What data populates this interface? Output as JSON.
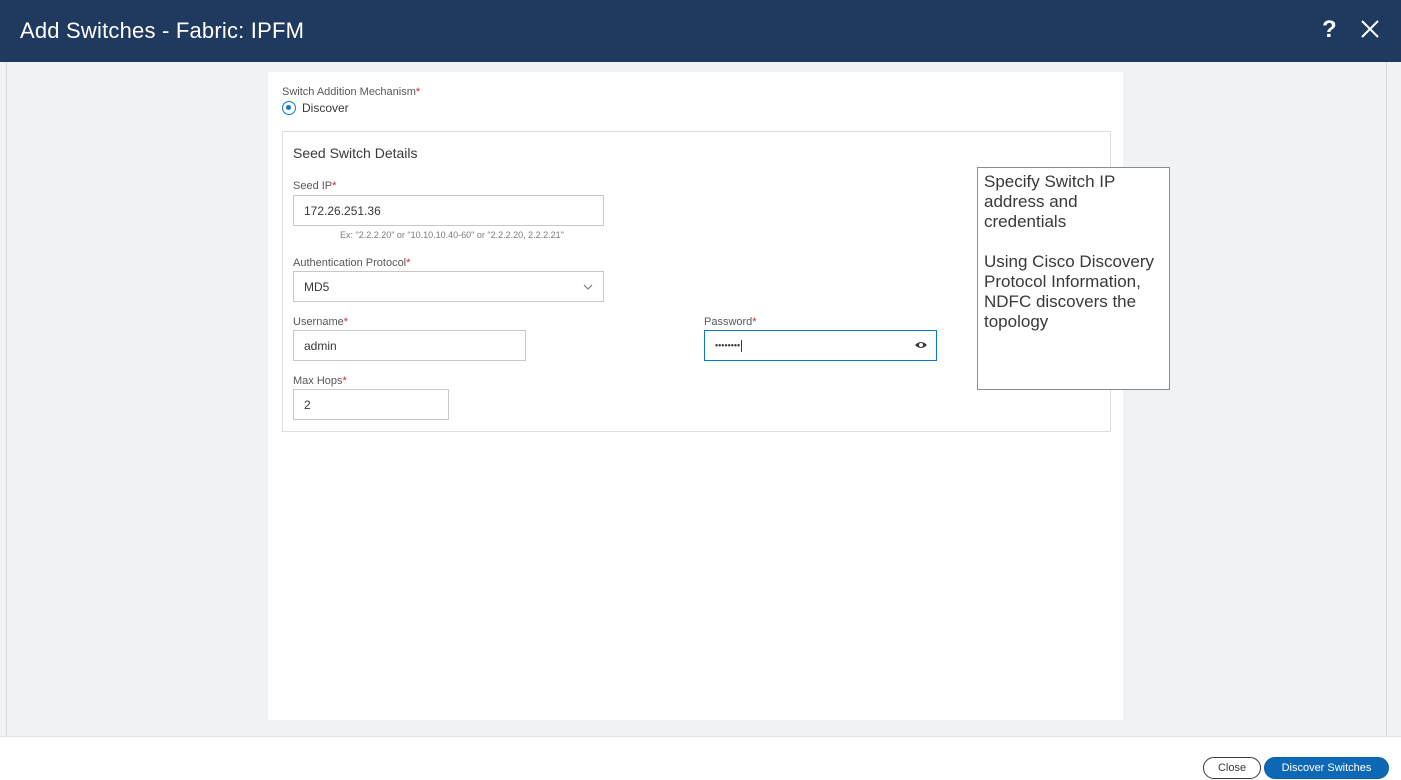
{
  "window": {
    "title": "Add Switches - Fabric: IPFM",
    "help_label": "?"
  },
  "mechanism": {
    "label": "Switch Addition Mechanism",
    "required_mark": "*",
    "option": "Discover"
  },
  "seed": {
    "section_title": "Seed Switch Details",
    "ip_label": "Seed IP",
    "ip_value": "172.26.251.36",
    "ip_hint": "Ex: \"2.2.2.20\" or \"10.10.10.40-60\" or \"2.2.2.20, 2.2.2.21\"",
    "auth_label": "Authentication Protocol",
    "auth_value": "MD5",
    "username_label": "Username",
    "username_value": "admin",
    "password_label": "Password",
    "password_masked": "••••••••",
    "maxhops_label": "Max Hops",
    "maxhops_value": "2"
  },
  "callout": {
    "line1": "Specify Switch IP address and credentials",
    "line2": "Using Cisco Discovery Protocol Information, NDFC discovers the topology"
  },
  "footer": {
    "close_label": "Close",
    "discover_label": "Discover Switches"
  },
  "colors": {
    "titlebar": "#1f3a5e",
    "accent": "#0d68b5",
    "required": "#cf2030"
  },
  "icons": [
    "help-icon",
    "close-icon",
    "radio-selected-icon",
    "chevron-down-icon",
    "eye-icon"
  ]
}
